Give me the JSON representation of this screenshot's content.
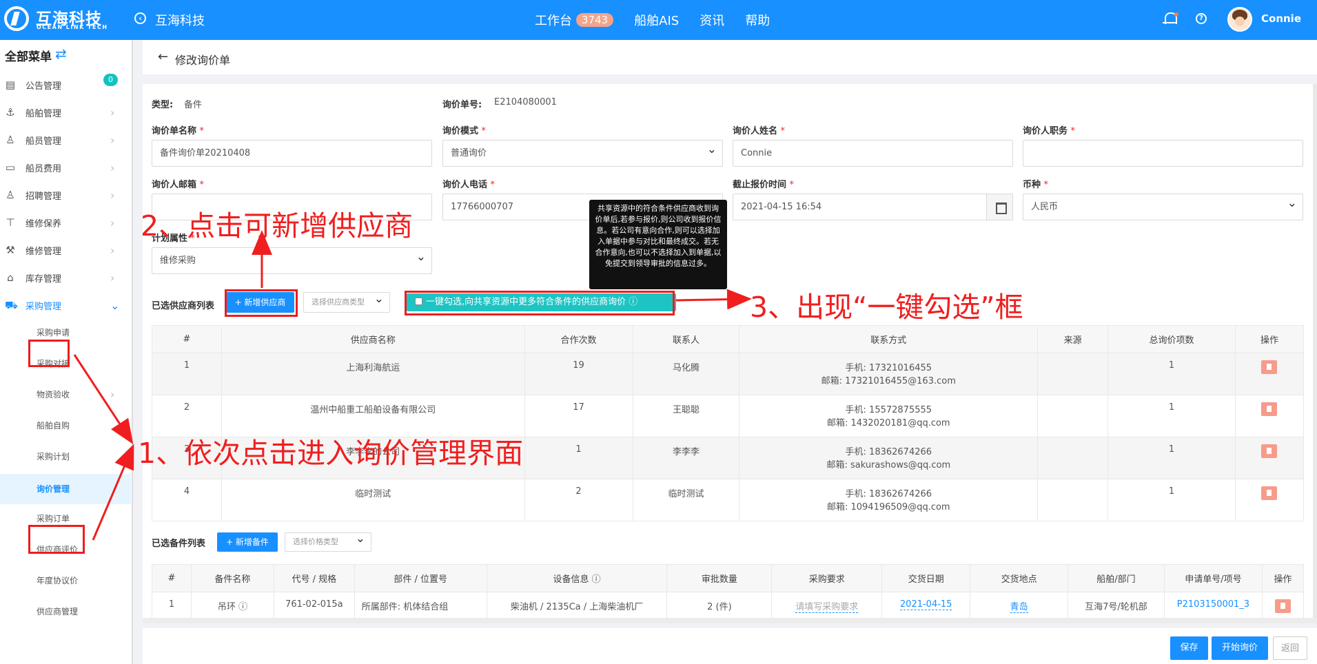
{
  "header": {
    "brand_cn": "互海科技",
    "brand_en": "OCEAN LINK TECH",
    "company": "互海科技",
    "nav": [
      {
        "label": "工作台",
        "badge": "3743"
      },
      {
        "label": "船舶AIS"
      },
      {
        "label": "资讯"
      },
      {
        "label": "帮助"
      }
    ],
    "user": "Connie"
  },
  "sidebar": {
    "title": "全部菜单",
    "items": [
      {
        "label": "公告管理",
        "icon": "book-icon",
        "badge": "0"
      },
      {
        "label": "船舶管理",
        "icon": "anchor-icon"
      },
      {
        "label": "船员管理",
        "icon": "person-icon"
      },
      {
        "label": "船员费用",
        "icon": "wallet-icon"
      },
      {
        "label": "招聘管理",
        "icon": "recruit-icon"
      },
      {
        "label": "维修保养",
        "icon": "tool-icon"
      },
      {
        "label": "维修管理",
        "icon": "wrench-icon"
      },
      {
        "label": "库存管理",
        "icon": "home-icon"
      },
      {
        "label": "采购管理",
        "icon": "cart-icon"
      }
    ],
    "sub_items": [
      "采购申请",
      "采购对接",
      "物资验收",
      "船舶自购",
      "采购计划",
      "询价管理",
      "采购订单",
      "供应商评价",
      "年度协议价",
      "供应商管理"
    ]
  },
  "page": {
    "title": "修改询价单"
  },
  "form": {
    "type_label": "类型:",
    "type_value": "备件",
    "no_label": "询价单号:",
    "no_value": "E2104080001",
    "name_label": "询价单名称",
    "name_value": "备件询价单20210408",
    "mode_label": "询价模式",
    "mode_value": "普通询价",
    "person_label": "询价人姓名",
    "person_value": "Connie",
    "duty_label": "询价人职务",
    "duty_value": "",
    "email_label": "询价人邮箱",
    "email_value": "",
    "phone_label": "询价人电话",
    "phone_value": "17766000707",
    "deadline_label": "截止报价时间",
    "deadline_value": "2021-04-15 16:54",
    "currency_label": "币种",
    "currency_value": "人民币",
    "plan_label": "计划属性",
    "plan_value": "维修采购"
  },
  "suppliers": {
    "label": "已选供应商列表",
    "add_button": "+ 新增供应商",
    "type_placeholder": "选择供应商类型",
    "one_click": "一键勾选,向共享资源中更多符合条件的供应商询价",
    "columns": [
      "#",
      "供应商名称",
      "合作次数",
      "联系人",
      "联系方式",
      "来源",
      "总询价项数",
      "操作"
    ],
    "rows": [
      {
        "no": "1",
        "name": "上海利海航运",
        "count": "19",
        "contact": "马化腾",
        "phone": "手机: 17321016455",
        "email": "邮箱: 17321016455@163.com",
        "source": "",
        "items": "1"
      },
      {
        "no": "2",
        "name": "温州中船重工船舶设备有限公司",
        "count": "17",
        "contact": "王聪聪",
        "phone": "手机: 15572875555",
        "email": "邮箱: 1432020181@qq.com",
        "source": "",
        "items": "1"
      },
      {
        "no": "3",
        "name": "李李李的公司",
        "count": "1",
        "contact": "李李李",
        "phone": "手机: 18362674266",
        "email": "邮箱: sakurashows@qq.com",
        "source": "",
        "items": "1"
      },
      {
        "no": "4",
        "name": "临时测试",
        "count": "2",
        "contact": "临时测试",
        "phone": "手机: 18362674266",
        "email": "邮箱: 1094196509@qq.com",
        "source": "",
        "items": "1"
      }
    ]
  },
  "tooltip": "共享资源中的符合条件供应商收到询价单后,若参与报价,则公司收到报价信息。若公司有意向合作,则可以选择加入单据中参与对比和最终成交。若无合作意向,也可以不选择加入到单据,以免提交到领导审批的信息过多。",
  "parts": {
    "label": "已选备件列表",
    "add_button": "+ 新增备件",
    "price_placeholder": "选择价格类型",
    "columns": [
      "#",
      "备件名称",
      "代号 / 规格",
      "部件 / 位置号",
      "设备信息",
      "审批数量",
      "采购要求",
      "交货日期",
      "交货地点",
      "船舶/部门",
      "申请单号/项号",
      "操作"
    ],
    "rows": [
      {
        "no": "1",
        "name": "吊环",
        "code": "761-02-015a",
        "part": "所属部件: 机体结合组",
        "device": "柴油机 / 2135Ca / 上海柴油机厂",
        "qty": "2 (件)",
        "req": "请填写采购要求",
        "date": "2021-04-15",
        "place": "青岛",
        "dept": "互海7号/轮机部",
        "apply": "P2103150001_3"
      }
    ]
  },
  "footer": {
    "save": "保存",
    "start": "开始询价",
    "back": "返回"
  },
  "annotations": {
    "a1": "1、依次点击进入询价管理界面",
    "a2": "2、点击可新增供应商",
    "a3": "3、出现“一键勾选”框"
  },
  "colors": {
    "primary": "#1890ff",
    "teal": "#1ec4c4",
    "annotation_red": "#f01e1e",
    "badge": "#f5a38a"
  }
}
